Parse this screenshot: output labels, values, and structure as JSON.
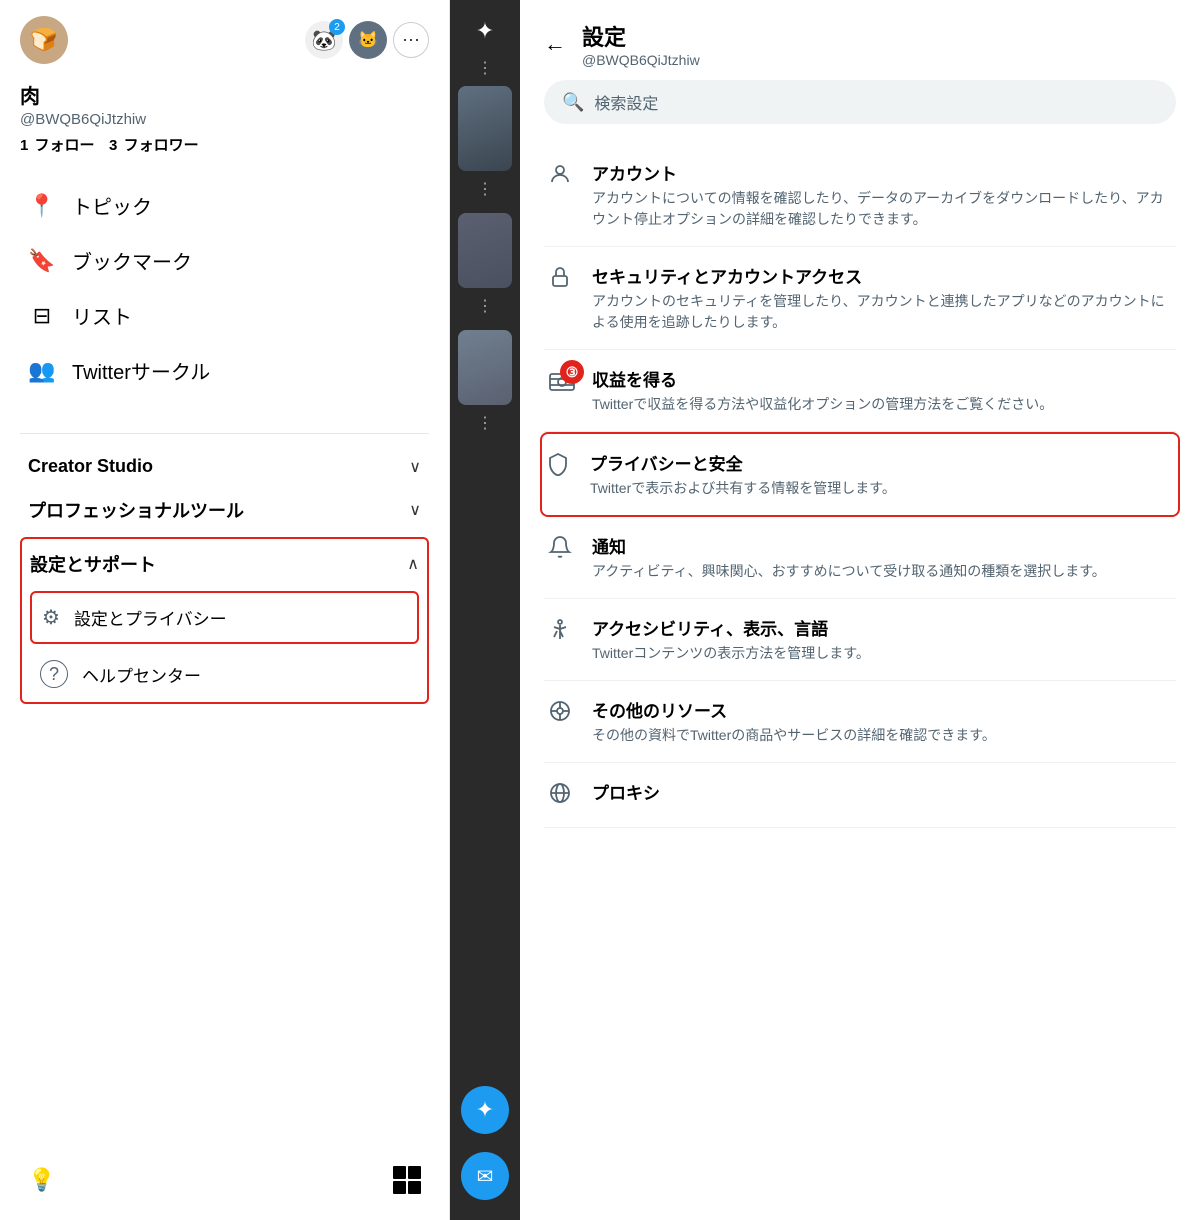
{
  "left": {
    "profile": {
      "name": "肉",
      "handle": "@BWQB6QiJtzhiw",
      "follow_count": "1",
      "follow_label": "フォロー",
      "follower_count": "3",
      "follower_label": "フォロワー"
    },
    "nav": [
      {
        "id": "topics",
        "icon": "📍",
        "label": "トピック"
      },
      {
        "id": "bookmarks",
        "icon": "🔖",
        "label": "ブックマーク"
      },
      {
        "id": "lists",
        "icon": "☰",
        "label": "リスト"
      },
      {
        "id": "circles",
        "icon": "👥",
        "label": "Twitterサークル"
      }
    ],
    "creator_studio": {
      "label": "Creator Studio",
      "chevron": "∨"
    },
    "professional_tools": {
      "label": "プロフェッショナルツール",
      "chevron": "∨"
    },
    "settings_support": {
      "label": "設定とサポート",
      "chevron": "∧"
    },
    "sub_nav": [
      {
        "id": "settings-privacy",
        "icon": "⚙",
        "label": "設定とプライバシー",
        "highlighted": true
      },
      {
        "id": "help",
        "icon": "?",
        "label": "ヘルプセンター",
        "highlighted": false
      }
    ],
    "badge_label": "2"
  },
  "right": {
    "header": {
      "back_label": "←",
      "title": "設定",
      "handle": "@BWQB6QiJtzhiw"
    },
    "search": {
      "placeholder": "検索設定"
    },
    "settings_items": [
      {
        "id": "account",
        "icon": "👤",
        "title": "アカウント",
        "desc": "アカウントについての情報を確認したり、データのアーカイブをダウンロードしたり、アカウント停止オプションの詳細を確認したりできます。",
        "highlighted": false
      },
      {
        "id": "security",
        "icon": "🔒",
        "title": "セキュリティとアカウントアクセス",
        "desc": "アカウントのセキュリティを管理したり、アカウントと連携したアプリなどのアカウントによる使用を追跡したりします。",
        "highlighted": false
      },
      {
        "id": "monetize",
        "icon": "💰",
        "title": "収益を得る",
        "desc": "Twitterで収益を得る方法や収益化オプションの管理方法をご覧ください。",
        "highlighted": false,
        "badge": "③"
      },
      {
        "id": "privacy",
        "icon": "🛡",
        "title": "プライバシーと安全",
        "desc": "Twitterで表示および共有する情報を管理します。",
        "highlighted": true
      },
      {
        "id": "notifications",
        "icon": "🔔",
        "title": "通知",
        "desc": "アクティビティ、興味関心、おすすめについて受け取る通知の種類を選択します。",
        "highlighted": false
      },
      {
        "id": "accessibility",
        "icon": "♿",
        "title": "アクセシビリティ、表示、言語",
        "desc": "Twitterコンテンツの表示方法を管理します。",
        "highlighted": false
      },
      {
        "id": "resources",
        "icon": "💬",
        "title": "その他のリソース",
        "desc": "その他の資料でTwitterの商品やサービスの詳細を確認できます。",
        "highlighted": false
      },
      {
        "id": "proxy",
        "icon": "🌐",
        "title": "プロキシ",
        "desc": "",
        "highlighted": false
      }
    ]
  }
}
